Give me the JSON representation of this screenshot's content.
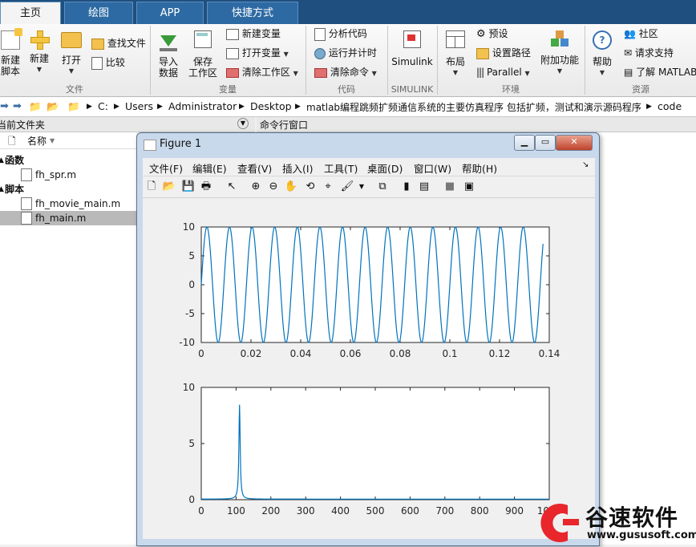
{
  "tabs": [
    "主页",
    "绘图",
    "APP",
    "快捷方式"
  ],
  "ribbon": {
    "file": {
      "new_script": "新建\n脚本",
      "new": "新建",
      "open": "打开",
      "find_files": "查找文件",
      "compare": "比较",
      "group": "文件"
    },
    "variable": {
      "import": "导入\n数据",
      "save_ws": "保存\n工作区",
      "new_var": "新建变量",
      "open_var": "打开变量",
      "clear_ws": "清除工作区",
      "group": "变量"
    },
    "code": {
      "analyze": "分析代码",
      "run_timer": "运行并计时",
      "clear_cmd": "清除命令",
      "group": "代码"
    },
    "simulink": {
      "label": "Simulink",
      "group": "SIMULINK"
    },
    "env": {
      "layout": "布局",
      "prefs": "预设",
      "set_path": "设置路径",
      "parallel": "Parallel",
      "addons": "附加功能",
      "group": "环境"
    },
    "resources": {
      "help": "帮助",
      "community": "社区",
      "support": "请求支持",
      "learn": "了解 MATLAB",
      "group": "资源"
    }
  },
  "address": [
    "C:",
    "Users",
    "Administrator",
    "Desktop",
    "matlab编程跳频扩频通信系统的主要仿真程序 包括扩频，测试和演示源码程序",
    "code"
  ],
  "file_panel": {
    "title": "当前文件夹",
    "col_name": "名称",
    "groups": [
      {
        "label": "函数",
        "files": [
          "fh_spr.m"
        ]
      },
      {
        "label": "脚本",
        "files": [
          "fh_movie_main.m",
          "fh_main.m"
        ]
      }
    ],
    "selected": "fh_main.m"
  },
  "cmd_panel": {
    "title": "命令行窗口"
  },
  "figure": {
    "title": "Figure 1",
    "menu": [
      "文件(F)",
      "编辑(E)",
      "查看(V)",
      "插入(I)",
      "工具(T)",
      "桌面(D)",
      "窗口(W)",
      "帮助(H)"
    ],
    "line_color": "#0072bd"
  },
  "chart_data": [
    {
      "type": "line",
      "title": "",
      "xlabel": "",
      "ylabel": "",
      "xlim": [
        0,
        0.14
      ],
      "ylim": [
        -10,
        10
      ],
      "xticks": [
        0,
        0.02,
        0.04,
        0.06,
        0.08,
        0.1,
        0.12,
        0.14
      ],
      "xtick_labels": [
        "0",
        "0.02",
        "0.04",
        "0.06",
        "0.08",
        "0.1",
        "0.12",
        "0.14"
      ],
      "yticks": [
        -10,
        -5,
        0,
        5,
        10
      ],
      "ytick_labels": [
        "-10",
        "-5",
        "0",
        "5",
        "10"
      ],
      "series": [
        {
          "function": "10*sin(2*pi*110*x)",
          "x_range": [
            0,
            0.1375
          ],
          "amplitude": 10,
          "frequency_hz": 110
        }
      ]
    },
    {
      "type": "line",
      "title": "",
      "xlabel": "",
      "ylabel": "",
      "xlim": [
        0,
        1000
      ],
      "ylim": [
        0,
        10
      ],
      "xticks": [
        0,
        100,
        200,
        300,
        400,
        500,
        600,
        700,
        800,
        900,
        1000
      ],
      "xtick_labels": [
        "0",
        "100",
        "200",
        "300",
        "400",
        "500",
        "600",
        "700",
        "800",
        "900",
        "1000"
      ],
      "yticks": [
        0,
        5,
        10
      ],
      "ytick_labels": [
        "0",
        "5",
        "10"
      ],
      "series": [
        {
          "description": "spectrum peak",
          "peak_x": 110,
          "peak_y": 8.4,
          "baseline": 0.05
        }
      ]
    }
  ],
  "watermark": {
    "brand": "谷速软件",
    "url": "www.gususoft.com",
    "color": "#e8262b"
  }
}
